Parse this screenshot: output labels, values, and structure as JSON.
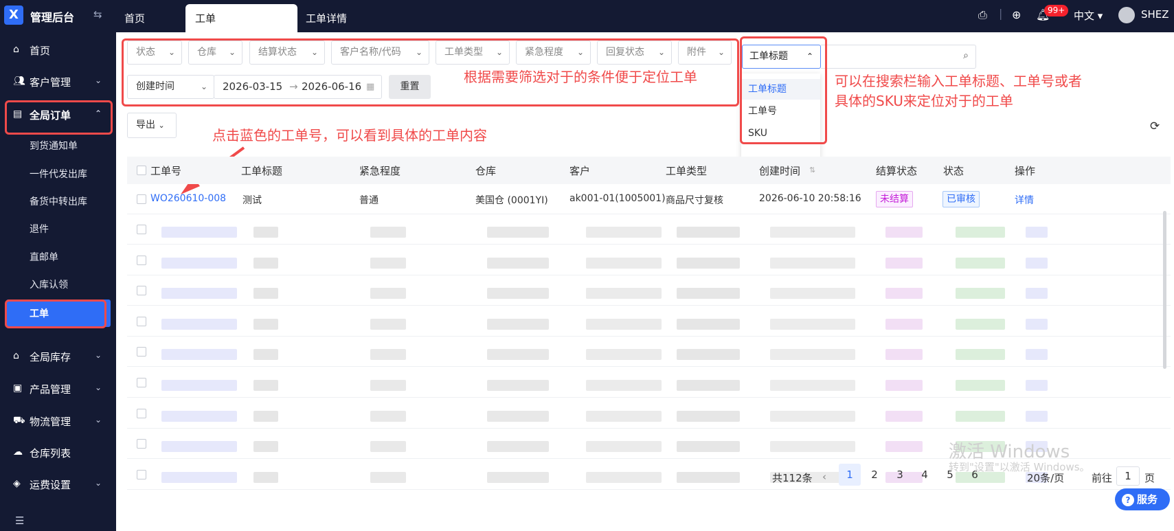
{
  "app": {
    "logo_letter": "X",
    "title": "管理后台"
  },
  "tabs": [
    {
      "label": "首页"
    },
    {
      "label": "工单"
    },
    {
      "label": "工单详情"
    }
  ],
  "header": {
    "notif_badge": "99+",
    "lang": "中文",
    "user": "SHEZ"
  },
  "sidebar": {
    "items": [
      {
        "label": "首页",
        "icon": "home-icon"
      },
      {
        "label": "客户管理",
        "icon": "users-icon"
      },
      {
        "label": "全局订单",
        "icon": "clipboard-icon"
      },
      {
        "label": "全局库存",
        "icon": "warehouse-icon"
      },
      {
        "label": "产品管理",
        "icon": "briefcase-icon"
      },
      {
        "label": "物流管理",
        "icon": "truck-icon"
      },
      {
        "label": "仓库列表",
        "icon": "cloud-icon"
      },
      {
        "label": "运费设置",
        "icon": "coin-icon"
      }
    ],
    "sub_items": [
      {
        "label": "到货通知单"
      },
      {
        "label": "一件代发出库"
      },
      {
        "label": "备货中转出库"
      },
      {
        "label": "退件"
      },
      {
        "label": "直邮单"
      },
      {
        "label": "入库认领"
      },
      {
        "label": "工单"
      }
    ]
  },
  "filters": [
    {
      "label": "状态"
    },
    {
      "label": "仓库"
    },
    {
      "label": "结算状态"
    },
    {
      "label": "客户名称/代码"
    },
    {
      "label": "工单类型"
    },
    {
      "label": "紧急程度"
    },
    {
      "label": "回复状态"
    },
    {
      "label": "附件"
    }
  ],
  "date_filter": {
    "type": "创建时间",
    "start": "2026-03-15",
    "arrow": "→",
    "end": "2026-06-16"
  },
  "reset_label": "重置",
  "search": {
    "field": "工单标题",
    "options": [
      "工单标题",
      "工单号",
      "SKU"
    ]
  },
  "annotations": {
    "filter_tip": "根据需要筛选对于的条件便于定位工单",
    "search_tip_1": "可以在搜索栏输入工单标题、工单号或者",
    "search_tip_2": "具体的SKU来定位对于的工单",
    "link_tip": "点击蓝色的工单号，可以看到具体的工单内容"
  },
  "export_label": "导出",
  "table": {
    "columns": [
      "工单号",
      "工单标题",
      "紧急程度",
      "仓库",
      "客户",
      "工单类型",
      "创建时间",
      "结算状态",
      "状态",
      "操作"
    ],
    "first_row": {
      "id": "WO260610-008",
      "title": "测试",
      "urgency": "普通",
      "warehouse": "美国仓 (0001YI)",
      "customer": "ak001-01(1005001)",
      "type": "商品尺寸复核",
      "created": "2026-06-10 20:58:16",
      "settle": "未结算",
      "status": "已审核",
      "action": "详情"
    }
  },
  "pagination": {
    "total": "共112条",
    "pages": [
      "1",
      "2",
      "3",
      "4",
      "5",
      "6"
    ],
    "per_page": "20条/页",
    "goto": "前往",
    "goto_value": "1",
    "page_unit": "页"
  },
  "service_label": "服务",
  "watermarks": [
    "激活 Windows",
    "转到\"设置\"以激活 Windows。"
  ],
  "colors": {
    "sidebar_bg": "#141a33",
    "accent": "#2f6df6",
    "annotation": "#f04a4a"
  }
}
